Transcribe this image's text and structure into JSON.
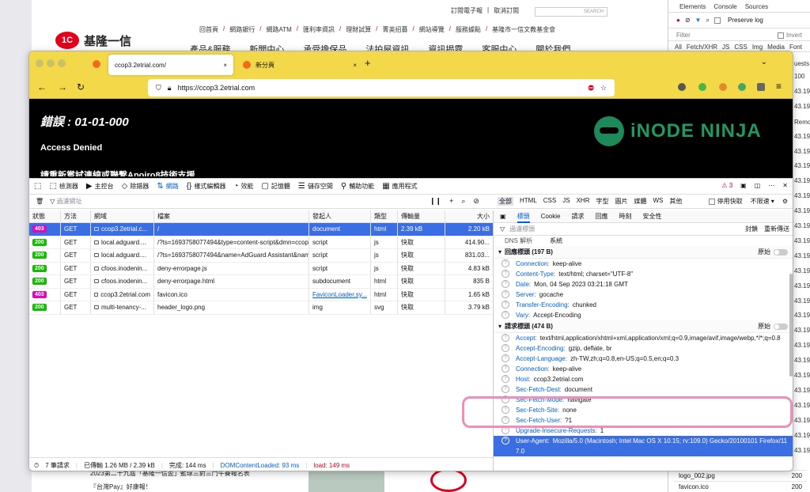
{
  "background_page": {
    "top_links": [
      "訂閱電子報",
      "取消訂閱"
    ],
    "search_placeholder": "SEARCH",
    "logo_mark": "1C",
    "logo_name": "基隆一信",
    "links": [
      "回首頁",
      "網路銀行",
      "網路ATM",
      "匯利率資訊",
      "理財試算",
      "菁英招募",
      "網站導覽",
      "服務據點",
      "基隆市一信文教基金會"
    ],
    "menu": [
      "產品&服務",
      "新聞中心",
      "承受擔保品",
      "法拍屋資訊",
      "資訊揭露",
      "客服中心",
      "關於我們"
    ],
    "news": [
      "2023第二十九屆「基隆一信盃」籃球三對三鬥牛賽報名表",
      "『台灣Pay』好康報！"
    ]
  },
  "right_devtools": {
    "tabs": [
      "Elements",
      "Console",
      "Sources"
    ],
    "preserve_log": "Preserve log",
    "filter_placeholder": "Filter",
    "invert": "Invert",
    "types": [
      "All",
      "Fetch/XHR",
      "JS",
      "CSS",
      "Img",
      "Media",
      "Font"
    ],
    "side_numbers": [
      "100",
      "43.19",
      "43.19",
      "43.19",
      "43.19",
      "43.19",
      "43.19",
      "43.19",
      "43.19",
      "43.19",
      "43.19",
      "43.19",
      "43.19",
      "43.19",
      "43.19",
      "43.19",
      "43.19",
      "43.19",
      "43.19",
      "43.19",
      "43.19",
      "43.19",
      "43.19",
      "43.19",
      "43.19",
      "43.19"
    ],
    "bottom_rows": [
      {
        "name": "logo_002.jpg",
        "status": "200"
      },
      {
        "name": "favicon.ico",
        "status": "200"
      }
    ],
    "partial_labels": [
      "uests",
      "Remo"
    ]
  },
  "firefox": {
    "tabs": [
      {
        "title": "ccop3.2etrial.com/",
        "close": "×"
      },
      {
        "title": "新分頁",
        "close": "×"
      }
    ],
    "new_tab": "+",
    "url": "https://ccop3.2etrial.com",
    "page": {
      "error_title": "錯誤 : 01-01-000",
      "access_denied": "Access Denied",
      "more_text": "請重新嘗試連線或聯繫Apoiro8技術支援",
      "brand": "iNODE NINJA"
    }
  },
  "devtools": {
    "tools": [
      "檢測器",
      "主控台",
      "除錯器",
      "網路",
      "樣式編輯器",
      "效能",
      "記憶體",
      "儲存空間",
      "輔助功能",
      "應用程式"
    ],
    "active_tool": "網路",
    "error_count": "3",
    "filter_placeholder": "過濾網址",
    "type_filters": [
      "全部",
      "HTML",
      "CSS",
      "JS",
      "XHR",
      "字型",
      "圖片",
      "媒體",
      "WS",
      "其他"
    ],
    "disable_cache": "停用快取",
    "throttle": "不限速 ▾",
    "columns": [
      "狀態",
      "方法",
      "網域",
      "檔案",
      "發起人",
      "類型",
      "傳輸量",
      "大小"
    ],
    "requests": [
      {
        "status": "403",
        "method": "GET",
        "domain": "ccop3.2etrial.c...",
        "file": "/",
        "initiator": "document",
        "type": "html",
        "transferred": "2.39 kB",
        "size": "2.20 kB",
        "selected": true
      },
      {
        "status": "200",
        "method": "GET",
        "domain": "local.adguard....",
        "file": "/?ts=1693758077494&type=content-script&dmn=ccop3.2etri",
        "initiator": "script",
        "type": "js",
        "transferred": "快取",
        "size": "414.90..."
      },
      {
        "status": "200",
        "method": "GET",
        "domain": "local.adguard....",
        "file": "/?ts=1693758077494&name=AdGuard Assistant&name=Ad",
        "initiator": "script",
        "type": "js",
        "transferred": "快取",
        "size": "831.03..."
      },
      {
        "status": "200",
        "method": "GET",
        "domain": "cfoos.inodenin...",
        "file": "deny-errorpage.js",
        "initiator": "script",
        "type": "js",
        "transferred": "快取",
        "size": "4.83 kB"
      },
      {
        "status": "200",
        "method": "GET",
        "domain": "cfoos.inodenin...",
        "file": "deny-errorpage.html",
        "initiator": "subdocument",
        "type": "html",
        "transferred": "快取",
        "size": "835 B"
      },
      {
        "status": "403",
        "method": "GET",
        "domain": "ccop3.2etrial.com",
        "file": "favicon.ico",
        "initiator": "FaviconLoader.sy...",
        "type": "html",
        "transferred": "快取",
        "size": "1.65 kB"
      },
      {
        "status": "200",
        "method": "GET",
        "domain": "multi-tenancy-...",
        "file": "header_logo.png",
        "initiator": "img",
        "type": "svg",
        "transferred": "快取",
        "size": "3.79 kB"
      }
    ],
    "status_bar": {
      "requests": "7 筆請求",
      "transferred": "已傳輸 1.26 MB / 2.39 kB",
      "finish": "完成: 144 ms",
      "dcl": "DOMContentLoaded: 93 ms",
      "load": "load: 149 ms"
    },
    "detail_tabs": [
      "標頭",
      "Cookie",
      "請求",
      "回應",
      "時刻",
      "安全性"
    ],
    "detail_filter": "過濾標頭",
    "block": "封鎖",
    "resend": "重新傳送",
    "dns_label": "DNS 解析",
    "dns_value": "系統",
    "response_headers_title": "回應標頭 (197 B)",
    "raw_label": "原始",
    "response_headers": [
      {
        "k": "Connection:",
        "v": "keep-alive"
      },
      {
        "k": "Content-Type:",
        "v": "text/html; charset=\"UTF-8\""
      },
      {
        "k": "Date:",
        "v": "Mon, 04 Sep 2023 03:21:18 GMT"
      },
      {
        "k": "Server:",
        "v": "gocache"
      },
      {
        "k": "Transfer-Encoding:",
        "v": "chunked"
      },
      {
        "k": "Vary:",
        "v": "Accept-Encoding"
      }
    ],
    "request_headers_title": "請求標頭 (474 B)",
    "request_headers": [
      {
        "k": "Accept:",
        "v": "text/html,application/xhtml+xml,application/xml;q=0.9,image/avif,image/webp,*/*;q=0.8"
      },
      {
        "k": "Accept-Encoding:",
        "v": "gzip, deflate, br"
      },
      {
        "k": "Accept-Language:",
        "v": "zh-TW,zh;q=0.8,en-US;q=0.5,en;q=0.3"
      },
      {
        "k": "Connection:",
        "v": "keep-alive"
      },
      {
        "k": "Host:",
        "v": "ccop3.2etrial.com"
      },
      {
        "k": "Sec-Fetch-Dest:",
        "v": "document"
      },
      {
        "k": "Sec-Fetch-Mode:",
        "v": "navigate"
      },
      {
        "k": "Sec-Fetch-Site:",
        "v": "none"
      },
      {
        "k": "Sec-Fetch-User:",
        "v": "?1"
      },
      {
        "k": "Upgrade-Insecure-Requests:",
        "v": "1"
      },
      {
        "k": "User-Agent:",
        "v": "Mozilla/5.0 (Macintosh; Intel Mac OS X 10.15; rv:109.0) Gecko/20100101 Firefox/117.0",
        "selected": true
      }
    ]
  },
  "colors": {
    "tabbar": "#f3d84a",
    "selected": "#3b6ee3",
    "highlight": "#ef8eb9",
    "link": "#0060df"
  }
}
